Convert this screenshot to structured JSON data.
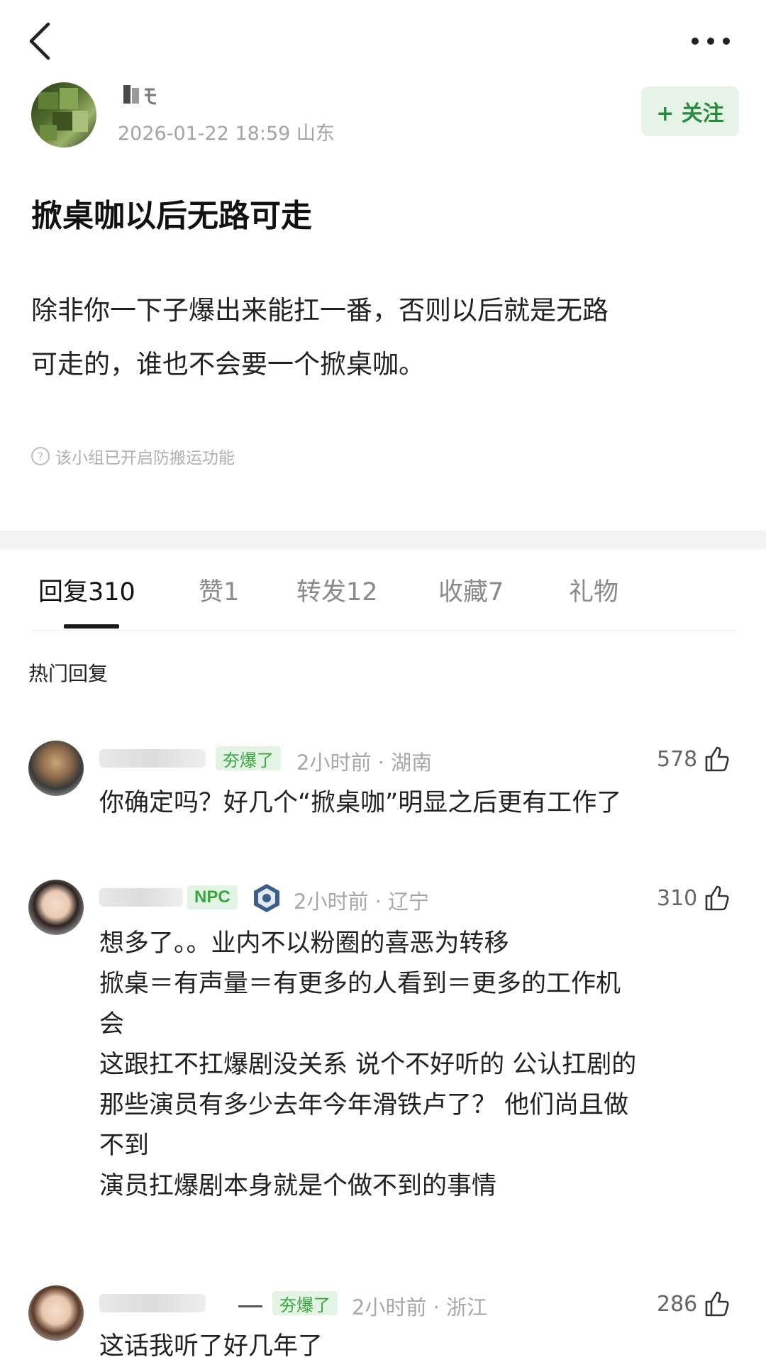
{
  "post": {
    "author_meta": "2026-01-22 18:59  山东",
    "follow_label": "+ 关注",
    "title": "掀桌咖以后无路可走",
    "body_lines": [
      "除非你一下子爆出来能扛一番，否则以后就是无路",
      "可走的，谁也不会要一个掀桌咖。"
    ],
    "notice": "该小组已开启防搬运功能"
  },
  "tabs": [
    {
      "label": "回复",
      "count": "310"
    },
    {
      "label": "赞",
      "count": "1"
    },
    {
      "label": "转发",
      "count": "12"
    },
    {
      "label": "收藏",
      "count": "7"
    },
    {
      "label": "礼物",
      "count": ""
    }
  ],
  "hot_label": "热门回复",
  "comments": [
    {
      "badge": "夯爆了",
      "meta": "2小时前 · 湖南",
      "likes": "578",
      "lines": [
        "你确定吗？好几个“掀桌咖”明显之后更有工作了"
      ]
    },
    {
      "badge": "NPC",
      "meta": "2小时前 · 辽宁",
      "likes": "310",
      "lines": [
        "想多了。。业内不以粉圈的喜恶为转移",
        "掀桌＝有声量＝有更多的人看到＝更多的工作机",
        "会",
        "这跟扛不扛爆剧没关系 说个不好听的 公认扛剧的",
        "那些演员有多少去年今年滑铁卢了？ 他们尚且做",
        "不到",
        "演员扛爆剧本身就是个做不到的事情"
      ]
    },
    {
      "badge": "夯爆了",
      "meta": "2小时前 · 浙江",
      "likes": "286",
      "lines": [
        "这话我听了好几年了"
      ]
    }
  ],
  "icons": [
    "back-icon",
    "more-icon",
    "question-icon",
    "like-icon",
    "rank-badge-icon"
  ],
  "colors": {
    "accent_green": "#2b8a3e",
    "badge_green_bg": "#e4f4e4",
    "meta_gray": "#a4a4a4"
  }
}
